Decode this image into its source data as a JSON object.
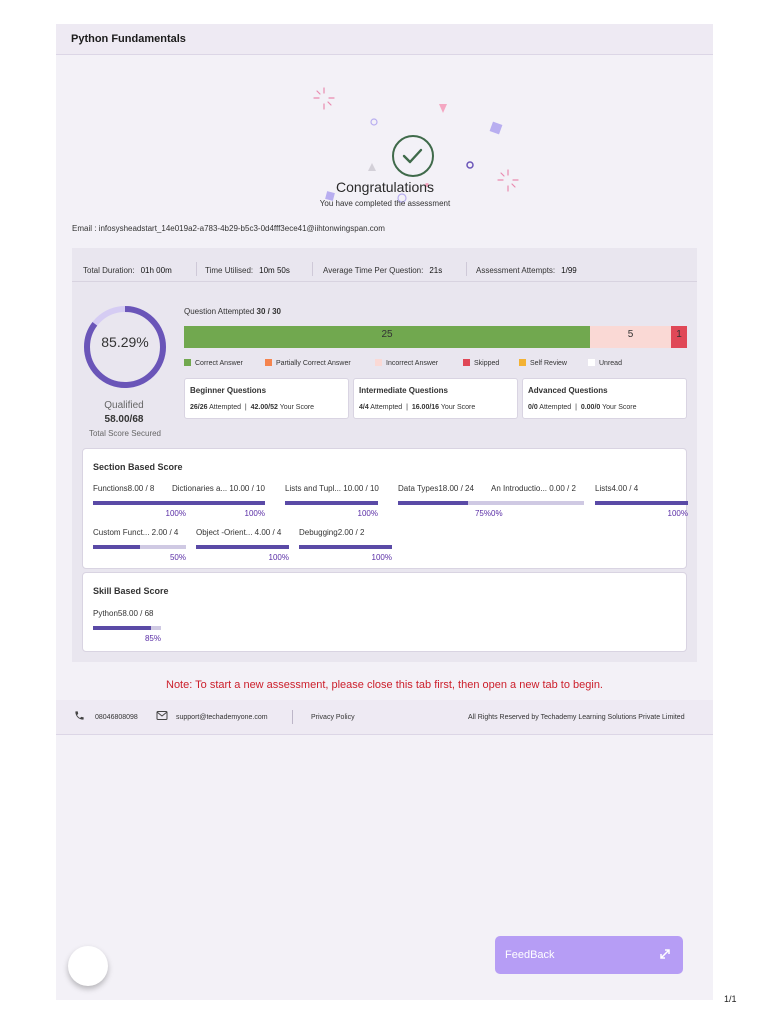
{
  "header": {
    "title": "Python Fundamentals"
  },
  "hero": {
    "title": "Congratulations",
    "subtitle": "You have completed the assessment"
  },
  "email": "Email : infosysheadstart_14e019a2-a783-4b29-b5c3-0d4fff3ece41@iihtonwingspan.com",
  "stats": [
    {
      "label": "Total Duration:",
      "value": "01h 00m"
    },
    {
      "label": "Time Utilised:",
      "value": "10m 50s"
    },
    {
      "label": "Average Time Per Question:",
      "value": "21s"
    },
    {
      "label": "Assessment Attempts:",
      "value": "1/99"
    }
  ],
  "summary": {
    "percentage": "85.29%",
    "percentage_value": 85.29,
    "status": "Qualified",
    "score": "58.00/68",
    "score_label": "Total Score Secured",
    "accent": "#6a55b8"
  },
  "attempted": {
    "prefix": "Question Attempted",
    "value": "30 / 30"
  },
  "question_bar": [
    {
      "label": "25",
      "count": 25,
      "color": "#71a84f",
      "text_color": "#333"
    },
    {
      "label": "5",
      "count": 5,
      "color": "#fad9d5",
      "text_color": "#333"
    },
    {
      "label": "1",
      "count": 1,
      "color": "#e04857",
      "text_color": "#333"
    }
  ],
  "legend": [
    {
      "label": "Correct Answer",
      "color": "#71a84f"
    },
    {
      "label": "Partially Correct Answer",
      "color": "#f5844e"
    },
    {
      "label": "Incorrect Answer",
      "color": "#fad9d5"
    },
    {
      "label": "Skipped",
      "color": "#e04857"
    },
    {
      "label": "Self Review",
      "color": "#f3b234"
    },
    {
      "label": "Unread",
      "color": "#ffffff"
    }
  ],
  "difficulty": [
    {
      "title": "Beginner Questions",
      "attempted": "26/26",
      "attempted_label": "Attempted",
      "score": "42.00/52",
      "score_label": "Your Score"
    },
    {
      "title": "Intermediate Questions",
      "attempted": "4/4",
      "attempted_label": "Attempted",
      "score": "16.00/16",
      "score_label": "Your Score"
    },
    {
      "title": "Advanced Questions",
      "attempted": "0/0",
      "attempted_label": "Attempted",
      "score": "0.00/0",
      "score_label": "Your Score"
    }
  ],
  "section_score": {
    "title": "Section Based Score",
    "items": [
      {
        "name": "Functions8.00 / 8",
        "percent_label": "100%",
        "value": 1.0
      },
      {
        "name": "Dictionaries a... 10.00 / 10",
        "percent_label": "100%",
        "value": 1.0
      },
      {
        "name": "Lists and Tupl... 10.00 / 10",
        "percent_label": "100%",
        "value": 1.0
      },
      {
        "name": "Data Types18.00 / 24",
        "percent_label": "75%",
        "value": 0.75
      },
      {
        "name": "An Introductio... 0.00 / 2",
        "percent_label": "0%",
        "value": 0.0
      },
      {
        "name": "Lists4.00 / 4",
        "percent_label": "100%",
        "value": 1.0
      },
      {
        "name": "Custom Funct... 2.00 / 4",
        "percent_label": "50%",
        "value": 0.5
      },
      {
        "name": "Object -Orient... 4.00 / 4",
        "percent_label": "100%",
        "value": 1.0
      },
      {
        "name": "Debugging2.00 / 2",
        "percent_label": "100%",
        "value": 1.0
      }
    ]
  },
  "skill_score": {
    "title": "Skill Based Score",
    "items": [
      {
        "name": "Python58.00 / 68",
        "percent_label": "85%",
        "value": 0.85
      }
    ]
  },
  "note": "Note: To start a new assessment, please close this tab first, then open a new tab to begin.",
  "footer": {
    "phone": "08046808098",
    "email": "support@techademyone.com",
    "privacy": "Privacy Policy",
    "rights": "All Rights Reserved by Techademy Learning Solutions Private Limited"
  },
  "feedback": {
    "label": "FeedBack"
  },
  "pager": "1/1",
  "icons": [
    "check-circle-icon",
    "phone-icon",
    "mail-icon",
    "expand-icon"
  ]
}
